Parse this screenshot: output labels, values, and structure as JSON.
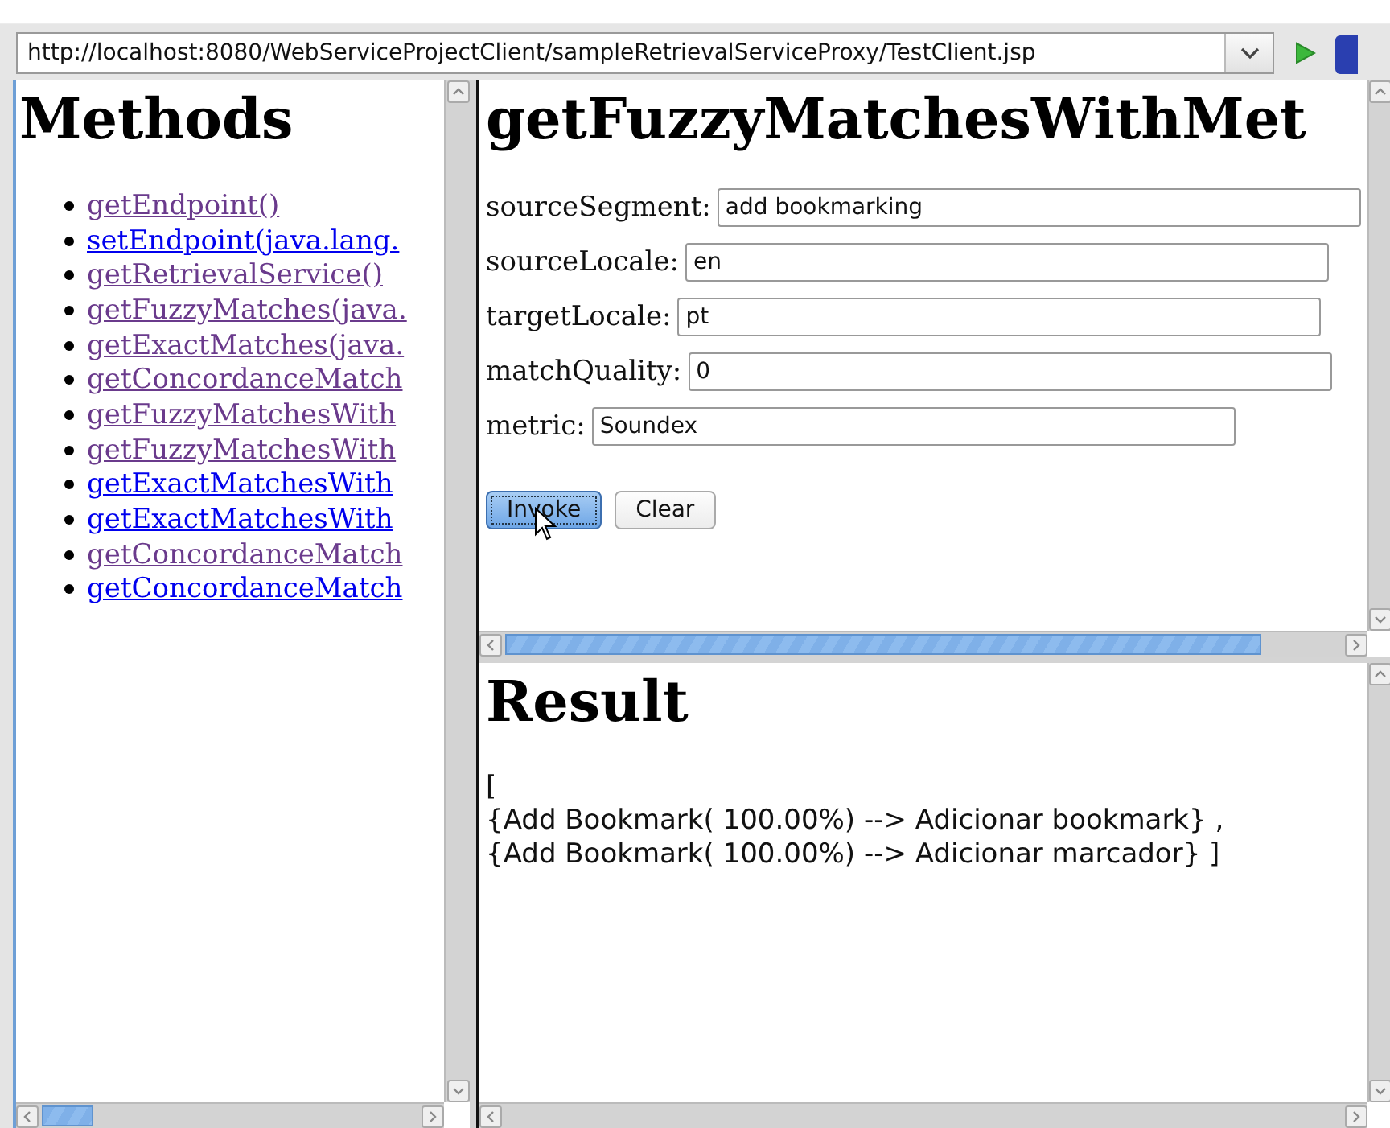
{
  "address_bar": {
    "url": "http://localhost:8080/WebServiceProjectClient/sampleRetrievalServiceProxy/TestClient.jsp"
  },
  "methods": {
    "title": "Methods",
    "items": [
      {
        "label": "getEndpoint()",
        "visited": true
      },
      {
        "label": "setEndpoint(java.lang.",
        "visited": false
      },
      {
        "label": "getRetrievalService()",
        "visited": true
      },
      {
        "label": "getFuzzyMatches(java.",
        "visited": true
      },
      {
        "label": "getExactMatches(java.",
        "visited": true
      },
      {
        "label": "getConcordanceMatch",
        "visited": true
      },
      {
        "label": "getFuzzyMatchesWith",
        "visited": true
      },
      {
        "label": "getFuzzyMatchesWith",
        "visited": true
      },
      {
        "label": "getExactMatchesWith",
        "visited": false
      },
      {
        "label": "getExactMatchesWith",
        "visited": false
      },
      {
        "label": "getConcordanceMatch",
        "visited": true
      },
      {
        "label": "getConcordanceMatch",
        "visited": false
      }
    ]
  },
  "form": {
    "title": "getFuzzyMatchesWithMet",
    "fields": [
      {
        "label": "sourceSegment:",
        "value": "add bookmarking"
      },
      {
        "label": "sourceLocale:",
        "value": "en"
      },
      {
        "label": "targetLocale:",
        "value": "pt"
      },
      {
        "label": "matchQuality:",
        "value": "0"
      },
      {
        "label": "metric:",
        "value": "Soundex"
      }
    ],
    "buttons": [
      {
        "label": "Invoke",
        "pressed": true
      },
      {
        "label": "Clear",
        "pressed": false
      }
    ]
  },
  "result": {
    "title": "Result",
    "lines": [
      "[",
      "{Add Bookmark( 100.00%) --> Adicionar bookmark} ,",
      "{Add Bookmark( 100.00%) --> Adicionar marcador} ]"
    ]
  }
}
